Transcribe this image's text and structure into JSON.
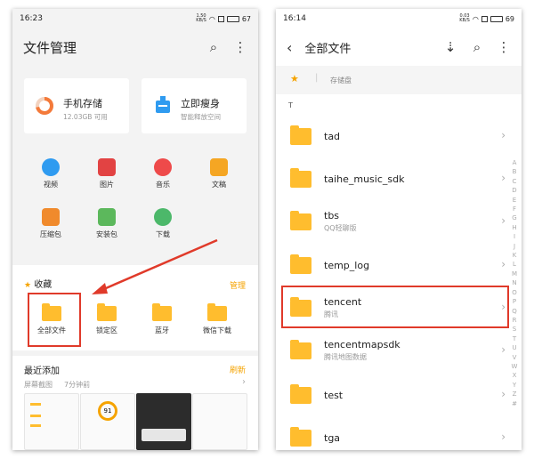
{
  "left": {
    "status": {
      "time": "16:23",
      "net_rate": "1.50",
      "net_unit": "KB/S",
      "battery": "67"
    },
    "title": "文件管理",
    "storage": {
      "label": "手机存储",
      "sub": "12.03GB 可用"
    },
    "cleanup": {
      "label": "立即瘦身",
      "sub": "智能释放空间"
    },
    "categories": [
      {
        "label": "视频",
        "color": "#2f9bf0",
        "icon": "video-icon"
      },
      {
        "label": "图片",
        "color": "#e24343",
        "icon": "picture-icon"
      },
      {
        "label": "音乐",
        "color": "#ee4a4a",
        "icon": "music-icon"
      },
      {
        "label": "文稿",
        "color": "#f5a623",
        "icon": "document-icon"
      },
      {
        "label": "压缩包",
        "color": "#f08a2c",
        "icon": "archive-icon"
      },
      {
        "label": "安装包",
        "color": "#5cb85c",
        "icon": "apk-icon"
      },
      {
        "label": "下载",
        "color": "#4cb86a",
        "icon": "download-icon"
      }
    ],
    "favorites": {
      "title": "收藏",
      "manage": "管理",
      "items": [
        "全部文件",
        "锁定区",
        "蓝牙",
        "微信下载"
      ]
    },
    "recent": {
      "title": "最近添加",
      "refresh": "刷新",
      "group": "屏幕截图",
      "time": "7分钟前",
      "thumb_value": "91"
    }
  },
  "right": {
    "status": {
      "time": "16:14",
      "net_rate": "0.03",
      "net_unit": "KB/S",
      "battery": "69"
    },
    "title": "全部文件",
    "breadcrumb": "存储盘",
    "section": "T",
    "rows": [
      {
        "name": "tad",
        "sub": ""
      },
      {
        "name": "taihe_music_sdk",
        "sub": ""
      },
      {
        "name": "tbs",
        "sub": "QQ轻聊版"
      },
      {
        "name": "temp_log",
        "sub": ""
      },
      {
        "name": "tencent",
        "sub": "腾讯"
      },
      {
        "name": "tencentmapsdk",
        "sub": "腾讯地图数据"
      },
      {
        "name": "test",
        "sub": ""
      },
      {
        "name": "tga",
        "sub": ""
      }
    ],
    "alphabet": [
      "A",
      "B",
      "C",
      "D",
      "E",
      "F",
      "G",
      "H",
      "I",
      "J",
      "K",
      "L",
      "M",
      "N",
      "O",
      "P",
      "Q",
      "R",
      "S",
      "T",
      "U",
      "V",
      "W",
      "X",
      "Y",
      "Z",
      "#"
    ]
  },
  "colors": {
    "accent": "#f5a300",
    "folder": "#ffbd2e",
    "highlight": "#e03a2a"
  }
}
